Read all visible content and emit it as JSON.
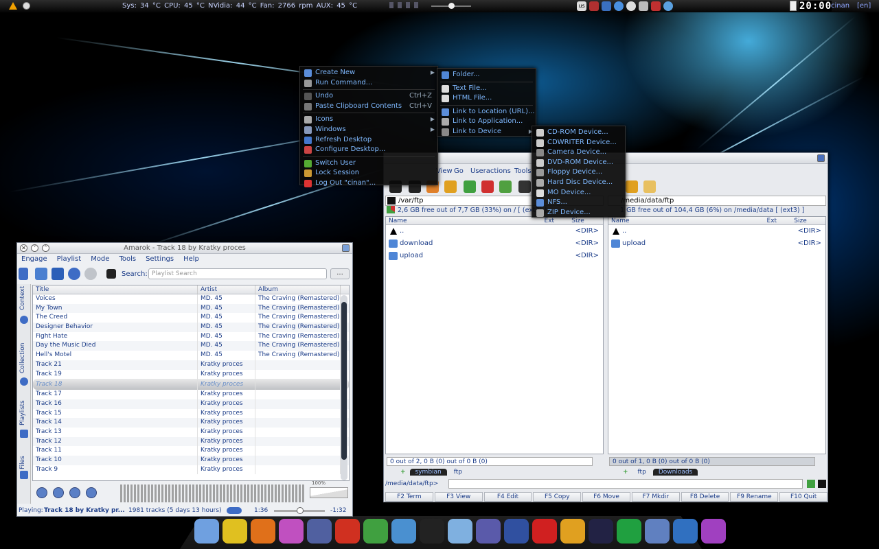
{
  "panel": {
    "sensors": "Sys: 34 °C   CPU: 45 °C   NVidia: 44 °C   Fan: 2766 rpm   AUX: 45 °C",
    "tray_layout": "us",
    "clock": "20:00",
    "user": "cinan",
    "lang": "[en]"
  },
  "desktop_menu": {
    "items": [
      {
        "label": "Create New",
        "icon": "star-icon",
        "submenu": true,
        "color": "#5b8dd9"
      },
      {
        "label": "Run Command...",
        "icon": "gear-icon",
        "color": "#999999"
      },
      {
        "label": "Undo",
        "icon": "undo-icon",
        "shortcut": "Ctrl+Z",
        "color": "#555555"
      },
      {
        "label": "Paste Clipboard Contents",
        "icon": "paste-icon",
        "shortcut": "Ctrl+V",
        "color": "#777777"
      },
      {
        "label": "Icons",
        "icon": "icons-icon",
        "submenu": true,
        "color": "#aaaaaa"
      },
      {
        "label": "Windows",
        "icon": "windows-icon",
        "submenu": true,
        "color": "#8899bb"
      },
      {
        "label": "Refresh Desktop",
        "icon": "refresh-icon",
        "color": "#4477cc"
      },
      {
        "label": "Configure Desktop...",
        "icon": "tools-icon",
        "color": "#cc4444"
      },
      {
        "label": "Switch User",
        "icon": "switch-user-icon",
        "color": "#55aa33"
      },
      {
        "label": "Lock Session",
        "icon": "lock-icon",
        "color": "#cc9933"
      },
      {
        "label": "Log Out \"cinan\"...",
        "icon": "logout-icon",
        "color": "#dd3333"
      }
    ]
  },
  "create_new_menu": {
    "items": [
      {
        "label": "Folder...",
        "icon": "folder-icon",
        "color": "#4f86d6"
      },
      {
        "label": "Text File...",
        "icon": "text-file-icon",
        "color": "#dddddd"
      },
      {
        "label": "HTML File...",
        "icon": "html-file-icon",
        "color": "#dddddd"
      },
      {
        "label": "Link to Location (URL)...",
        "icon": "link-icon",
        "color": "#5b8dd9"
      },
      {
        "label": "Link to Application...",
        "icon": "gears-icon",
        "color": "#aaaaaa"
      },
      {
        "label": "Link to Device",
        "icon": "device-icon",
        "submenu": true,
        "color": "#888888"
      }
    ]
  },
  "device_menu": {
    "items": [
      {
        "label": "CD-ROM Device...",
        "icon": "cdrom-icon",
        "color": "#cccccc"
      },
      {
        "label": "CDWRITER Device...",
        "icon": "cdwriter-icon",
        "color": "#cccccc"
      },
      {
        "label": "Camera Device...",
        "icon": "camera-icon",
        "color": "#888888"
      },
      {
        "label": "DVD-ROM Device...",
        "icon": "dvd-icon",
        "color": "#cccccc"
      },
      {
        "label": "Floppy Device...",
        "icon": "floppy-icon",
        "color": "#999999"
      },
      {
        "label": "Hard Disc Device...",
        "icon": "harddisk-icon",
        "color": "#aaaaaa"
      },
      {
        "label": "MO Device...",
        "icon": "mo-icon",
        "color": "#dddddd"
      },
      {
        "label": "NFS...",
        "icon": "nfs-icon",
        "color": "#5b8dd9"
      },
      {
        "label": "ZIP Device...",
        "icon": "zip-icon",
        "color": "#aaaaaa"
      }
    ]
  },
  "amarok": {
    "title": "Amarok - Track 18 by Kratky proces",
    "menu": [
      "Engage",
      "Playlist",
      "Mode",
      "Tools",
      "Settings",
      "Help"
    ],
    "search_label": "Search:",
    "search_placeholder": "Playlist Search",
    "search_btn": "...",
    "sidetabs": [
      "Context",
      "Collection",
      "Playlists",
      "Files"
    ],
    "columns": [
      "Title",
      "Artist",
      "Album"
    ],
    "rows": [
      {
        "title": "Voices",
        "artist": "MD. 45",
        "album": "The Craving (Remastered)"
      },
      {
        "title": "My Town",
        "artist": "MD. 45",
        "album": "The Craving (Remastered)"
      },
      {
        "title": "The Creed",
        "artist": "MD. 45",
        "album": "The Craving (Remastered)"
      },
      {
        "title": "Designer Behavior",
        "artist": "MD. 45",
        "album": "The Craving (Remastered)"
      },
      {
        "title": "Fight Hate",
        "artist": "MD. 45",
        "album": "The Craving (Remastered)"
      },
      {
        "title": "Day the Music Died",
        "artist": "MD. 45",
        "album": "The Craving (Remastered)"
      },
      {
        "title": "Hell's Motel",
        "artist": "MD. 45",
        "album": "The Craving (Remastered)"
      },
      {
        "title": "Track 21",
        "artist": "Kratky proces",
        "album": ""
      },
      {
        "title": "Track 19",
        "artist": "Kratky proces",
        "album": ""
      },
      {
        "title": "Track 18",
        "artist": "Kratky proces",
        "album": "",
        "current": true
      },
      {
        "title": "Track 17",
        "artist": "Kratky proces",
        "album": ""
      },
      {
        "title": "Track 16",
        "artist": "Kratky proces",
        "album": ""
      },
      {
        "title": "Track 15",
        "artist": "Kratky proces",
        "album": ""
      },
      {
        "title": "Track 14",
        "artist": "Kratky proces",
        "album": ""
      },
      {
        "title": "Track 13",
        "artist": "Kratky proces",
        "album": ""
      },
      {
        "title": "Track 12",
        "artist": "Kratky proces",
        "album": ""
      },
      {
        "title": "Track 11",
        "artist": "Kratky proces",
        "album": ""
      },
      {
        "title": "Track 10",
        "artist": "Kratky proces",
        "album": ""
      },
      {
        "title": "Track 9",
        "artist": "Kratky proces",
        "album": ""
      }
    ],
    "volume_label": "100%",
    "status_playing": "Playing:",
    "status_track": "Track 18 by Kratky pr...",
    "status_count": "1981 tracks (5 days 13 hours)",
    "time_elapsed": "1:36",
    "time_remaining": "-1:32",
    "progress": 0.52
  },
  "krusader": {
    "title": "",
    "menu": [
      "View",
      "Go",
      "Useractions",
      "Tools"
    ],
    "left": {
      "path": "/var/ftp",
      "free": "2,6 GB free out of 7,7 GB (33%) on / [ (ext3) ]",
      "columns": [
        "Name",
        "Ext",
        "Size"
      ],
      "rows": [
        {
          "name": "..",
          "size": "<DIR>",
          "up": true
        },
        {
          "name": "download",
          "size": "<DIR>"
        },
        {
          "name": "upload",
          "size": "<DIR>"
        }
      ],
      "status": "0 out of 2, 0 B (0) out of 0 B (0)",
      "tabs": [
        "symbian",
        "ftp"
      ],
      "active_tab": 0
    },
    "right": {
      "path": "/media/data/ftp",
      "free": "1 GB free out of 104,4 GB (6%) on /media/data [ (ext3) ]",
      "columns": [
        "Name",
        "Ext",
        "Size"
      ],
      "rows": [
        {
          "name": "..",
          "size": "<DIR>",
          "up": true
        },
        {
          "name": "upload",
          "size": "<DIR>"
        }
      ],
      "status": "0 out of 1, 0 B (0) out of 0 B (0)",
      "tabs": [
        "ftp",
        "Downloads"
      ],
      "active_tab": 1
    },
    "cmd_path": "/media/data/ftp>",
    "fkeys": [
      "F2 Term",
      "F3 View",
      "F4 Edit",
      "F5 Copy",
      "F6 Move",
      "F7 Mkdir",
      "F8 Delete",
      "F9 Rename",
      "F10 Quit"
    ]
  },
  "dock": {
    "icons": [
      {
        "name": "itunes-icon",
        "color": "#6fa0e0"
      },
      {
        "name": "radiation-icon",
        "color": "#e0c020"
      },
      {
        "name": "firefox-icon",
        "color": "#e0701a"
      },
      {
        "name": "inkscape-icon",
        "color": "#c050c0"
      },
      {
        "name": "quill-icon",
        "color": "#5060a0"
      },
      {
        "name": "hotspot-icon",
        "color": "#d03020"
      },
      {
        "name": "download-arrow-icon",
        "color": "#40a040"
      },
      {
        "name": "safari-icon",
        "color": "#4a90d0"
      },
      {
        "name": "terminal-icon",
        "color": "#222222"
      },
      {
        "name": "chat-icon",
        "color": "#7fb0e0"
      },
      {
        "name": "screenshot-icon",
        "color": "#5a5aaa"
      },
      {
        "name": "pen-icon",
        "color": "#3050a0"
      },
      {
        "name": "opera-icon",
        "color": "#d02020"
      },
      {
        "name": "hi-icon",
        "color": "#e0a020"
      },
      {
        "name": "video-icon",
        "color": "#222244"
      },
      {
        "name": "skype-icon",
        "color": "#20a040"
      },
      {
        "name": "settings-icon",
        "color": "#6080c0"
      },
      {
        "name": "monitor-icon",
        "color": "#3070c0"
      },
      {
        "name": "colors-icon",
        "color": "#a040c0"
      }
    ]
  }
}
